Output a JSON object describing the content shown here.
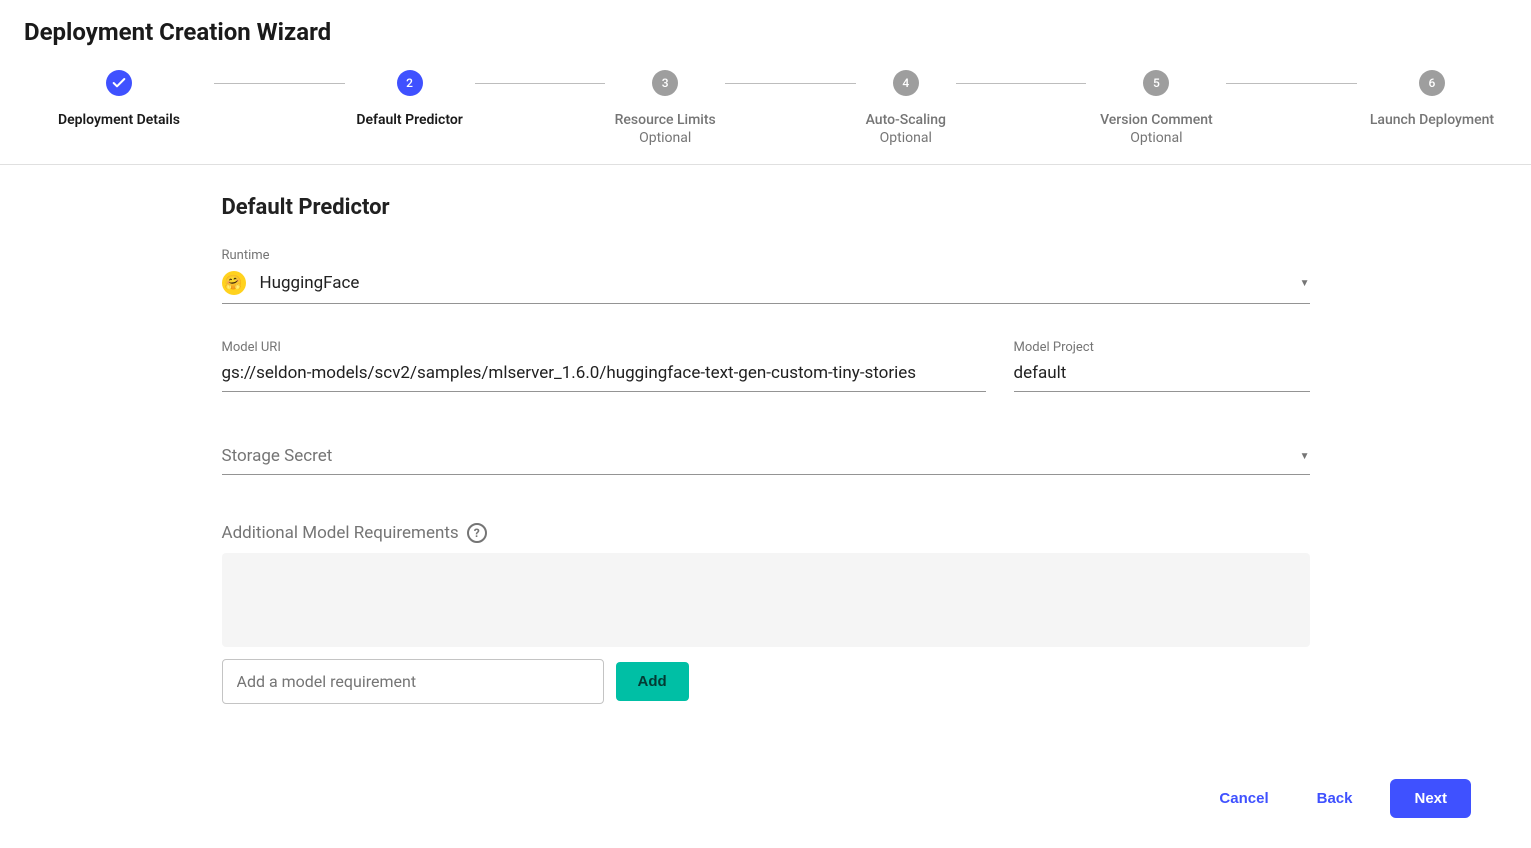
{
  "wizard": {
    "title": "Deployment Creation Wizard"
  },
  "steps": [
    {
      "num": "✓",
      "label": "Deployment Details",
      "sub": "",
      "state": "done"
    },
    {
      "num": "2",
      "label": "Default Predictor",
      "sub": "",
      "state": "active"
    },
    {
      "num": "3",
      "label": "Resource Limits",
      "sub": "Optional",
      "state": "pending"
    },
    {
      "num": "4",
      "label": "Auto-Scaling",
      "sub": "Optional",
      "state": "pending"
    },
    {
      "num": "5",
      "label": "Version Comment",
      "sub": "Optional",
      "state": "pending"
    },
    {
      "num": "6",
      "label": "Launch Deployment",
      "sub": "",
      "state": "pending"
    }
  ],
  "section": {
    "title": "Default Predictor"
  },
  "runtime": {
    "label": "Runtime",
    "value": "HuggingFace",
    "icon": "🤗"
  },
  "model_uri": {
    "label": "Model URI",
    "value": "gs://seldon-models/scv2/samples/mlserver_1.6.0/huggingface-text-gen-custom-tiny-stories"
  },
  "model_project": {
    "label": "Model Project",
    "value": "default"
  },
  "storage_secret": {
    "placeholder": "Storage Secret"
  },
  "requirements": {
    "label": "Additional Model Requirements",
    "input_placeholder": "Add a model requirement",
    "add_button": "Add"
  },
  "footer": {
    "cancel": "Cancel",
    "back": "Back",
    "next": "Next"
  }
}
